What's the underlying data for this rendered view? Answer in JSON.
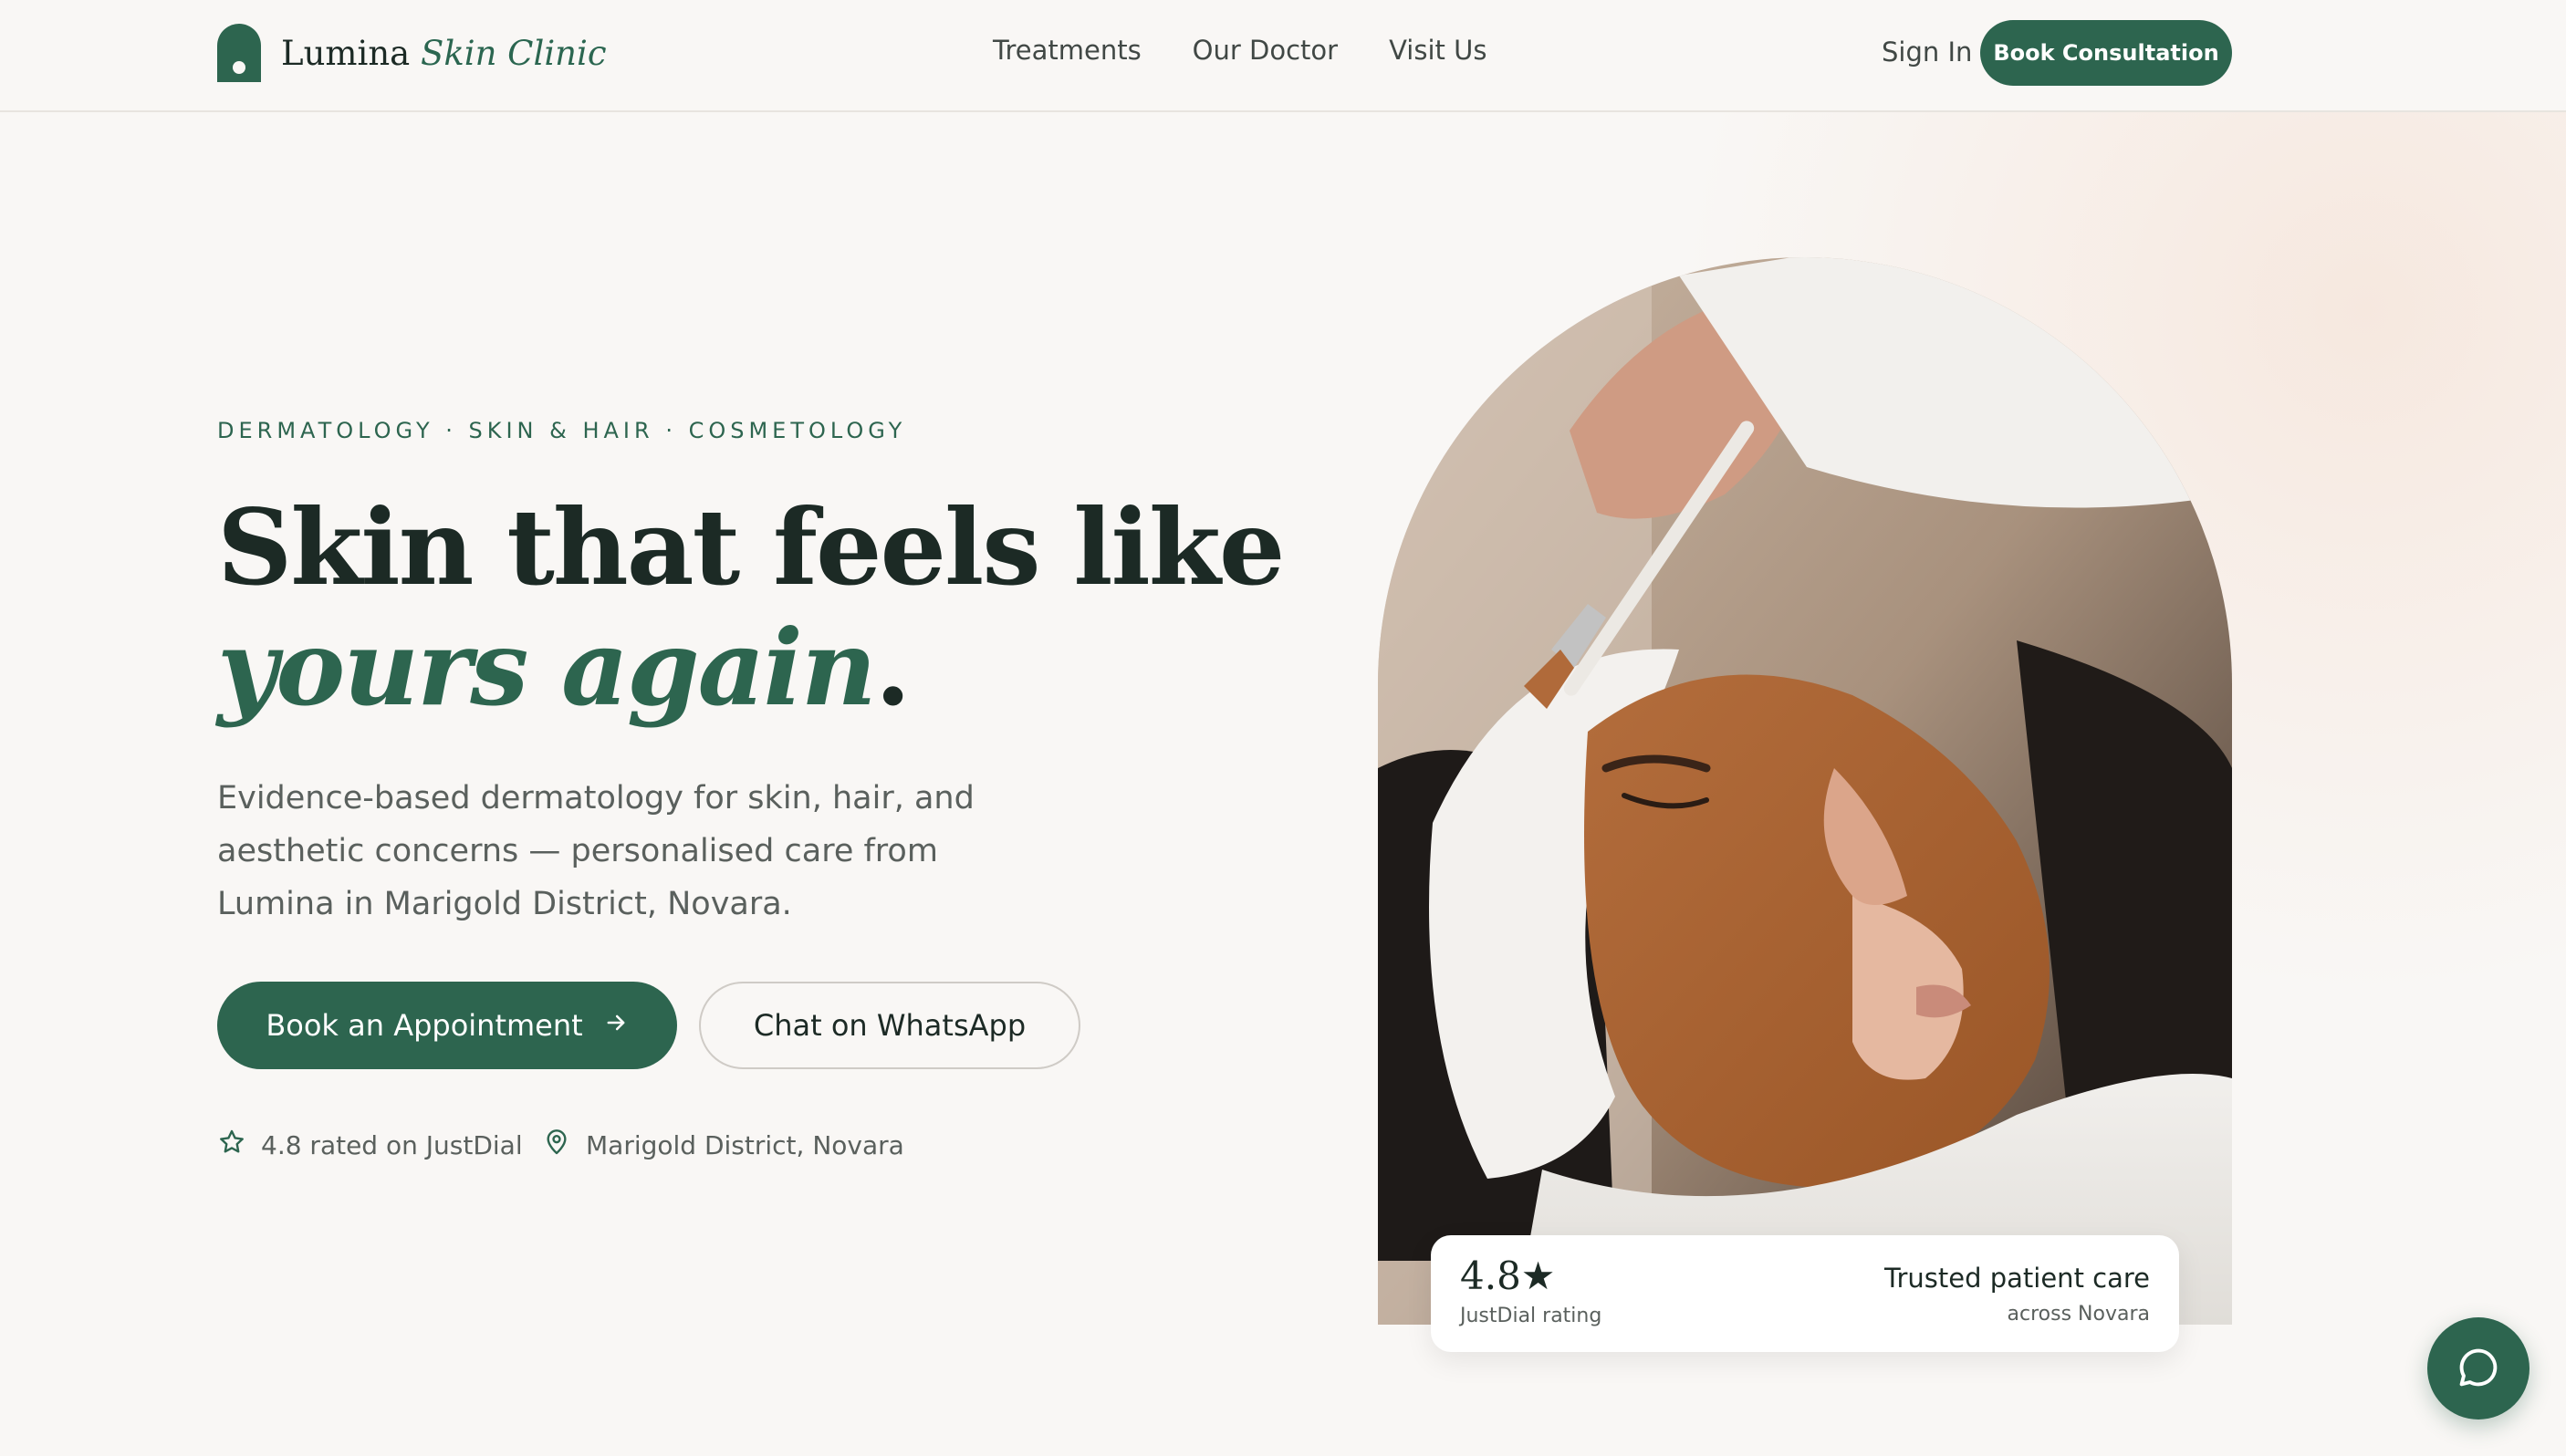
{
  "brand": {
    "name": "Lumina",
    "name_accent": "Skin Clinic"
  },
  "nav": {
    "items": [
      {
        "label": "Treatments"
      },
      {
        "label": "Our Doctor"
      },
      {
        "label": "Visit Us"
      }
    ]
  },
  "header": {
    "sign_in_label": "Sign In",
    "book_consultation_label": "Book Consultation"
  },
  "hero": {
    "eyebrow": "DERMATOLOGY · SKIN & HAIR · COSMETOLOGY",
    "headline_line1": "Skin that feels like",
    "headline_accent": "yours again",
    "headline_period": ".",
    "subtext": "Evidence-based dermatology for skin, hair, and aesthetic concerns — personalised care from Lumina in Marigold District, Novara.",
    "primary_cta": "Book an Appointment",
    "secondary_cta": "Chat on WhatsApp",
    "rating_meta": "4.8 rated on JustDial",
    "location_meta": "Marigold District, Novara"
  },
  "rating_card": {
    "score": "4.8★",
    "source": "JustDial rating",
    "trust_title": "Trusted patient care",
    "trust_sub": "across Novara"
  },
  "icons": {
    "logo": "arch-logo-icon",
    "arrow": "arrow-right-icon",
    "star": "star-icon",
    "pin": "map-pin-icon",
    "chat": "chat-bubble-icon"
  },
  "colors": {
    "brand_green": "#2d654f",
    "heading": "#1c2a25",
    "body_text": "#5a605d",
    "background": "#f9f7f5"
  }
}
